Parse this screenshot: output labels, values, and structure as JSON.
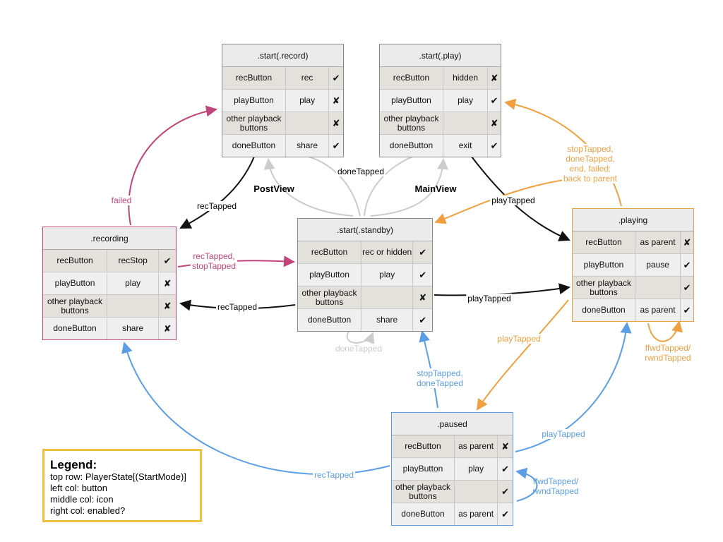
{
  "colors": {
    "neutral": "#8a8a8a",
    "recording": "#c0457a",
    "playing": "#f0a040",
    "paused": "#5b9ee6",
    "gray_edge": "#cccccc",
    "black_edge": "#111111"
  },
  "states": [
    {
      "id": "start-record",
      "title": ".start(.record)",
      "rows": [
        [
          "recButton",
          "rec",
          "✔"
        ],
        [
          "playButton",
          "play",
          "✘"
        ],
        [
          "other playback buttons",
          "",
          "✘"
        ],
        [
          "doneButton",
          "share",
          "✔"
        ]
      ]
    },
    {
      "id": "start-play",
      "title": ".start(.play)",
      "rows": [
        [
          "recButton",
          "hidden",
          "✘"
        ],
        [
          "playButton",
          "play",
          "✔"
        ],
        [
          "other playback buttons",
          "",
          "✘"
        ],
        [
          "doneButton",
          "exit",
          "✔"
        ]
      ]
    },
    {
      "id": "start-standby",
      "title": ".start(.standby)",
      "rows": [
        [
          "recButton",
          "rec or hidden",
          "✔"
        ],
        [
          "playButton",
          "play",
          "✔"
        ],
        [
          "other playback buttons",
          "",
          "✘"
        ],
        [
          "doneButton",
          "share",
          "✔"
        ]
      ]
    },
    {
      "id": "recording",
      "title": ".recording",
      "rows": [
        [
          "recButton",
          "recStop",
          "✔"
        ],
        [
          "playButton",
          "play",
          "✘"
        ],
        [
          "other playback buttons",
          "",
          "✘"
        ],
        [
          "doneButton",
          "share",
          "✘"
        ]
      ]
    },
    {
      "id": "playing",
      "title": ".playing",
      "rows": [
        [
          "recButton",
          "as parent",
          "✘"
        ],
        [
          "playButton",
          "pause",
          "✔"
        ],
        [
          "other playback buttons",
          "",
          "✔"
        ],
        [
          "doneButton",
          "as parent",
          "✔"
        ]
      ]
    },
    {
      "id": "paused",
      "title": ".paused",
      "rows": [
        [
          "recButton",
          "as parent",
          "✘"
        ],
        [
          "playButton",
          "play",
          "✔"
        ],
        [
          "other playback buttons",
          "",
          "✔"
        ],
        [
          "doneButton",
          "as parent",
          "✔"
        ]
      ]
    }
  ],
  "labels": {
    "failed": "failed",
    "rec_stop": "recTapped,\nstopTapped",
    "rec_from_record": "recTapped",
    "rec_from_standby": "recTapped",
    "play_from_play": "playTapped",
    "play_from_standby": "playTapped",
    "done_top": "doneTapped",
    "done_self": "doneTapped",
    "postview": "PostView",
    "mainview": "MainView",
    "back_to_parent": "stopTapped,\ndoneTapped,\nend, failed:\nback to parent",
    "playing_to_paused": "playTapped",
    "ffwd_playing": "ffwdTapped/\nrwndTapped",
    "rec_from_paused": "recTapped",
    "paused_to_standby": "stopTapped,\ndoneTapped",
    "paused_to_playing": "playTapped",
    "ffwd_paused": "ffwdTapped/\nrwndTapped"
  },
  "legend": {
    "title": "Legend:",
    "lines": [
      "top row: PlayerState[(StartMode)]",
      "left col: button",
      "middle col: icon",
      "right col: enabled?"
    ]
  }
}
